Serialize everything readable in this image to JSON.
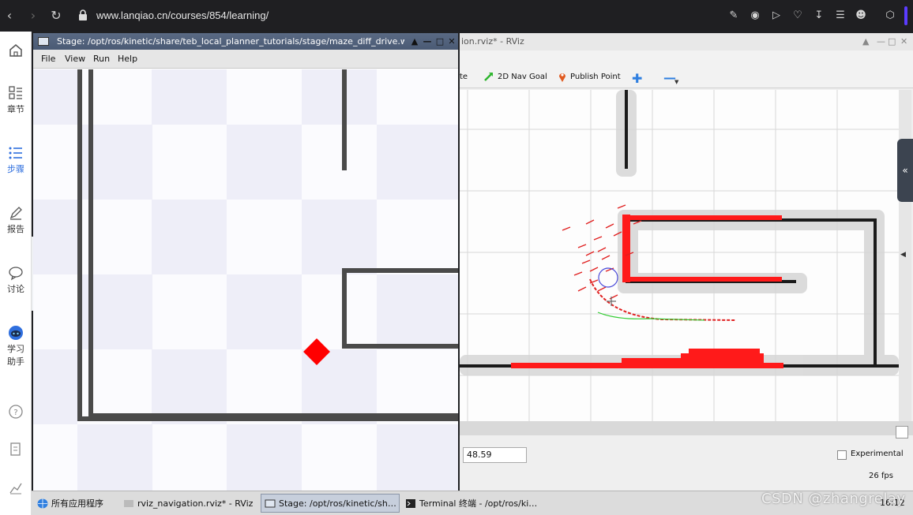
{
  "browser": {
    "url": "www.lanqiao.cn/courses/854/learning/"
  },
  "sidebar": {
    "items": [
      {
        "label": "章节",
        "icon": "chapters-icon"
      },
      {
        "label": "步骤",
        "icon": "steps-icon"
      },
      {
        "label": "报告",
        "icon": "report-icon"
      },
      {
        "label": "讨论",
        "icon": "discuss-icon"
      },
      {
        "label": "学习",
        "label2": "助手",
        "icon": "assistant-icon"
      }
    ],
    "active_color": "#2f6fde"
  },
  "stage": {
    "title": "Stage: /opt/ros/kinetic/share/teb_local_planner_tutorials/stage/maze_diff_drive.world",
    "menu": [
      "File",
      "View",
      "Run",
      "Help"
    ]
  },
  "rviz": {
    "title": "ion.rviz* - RViz",
    "toolbar": {
      "partial_label": "te",
      "nav_goal": "2D Nav Goal",
      "publish_point": "Publish Point"
    },
    "time_value": "48.59",
    "experimental_label": "Experimental",
    "fps": "26 fps"
  },
  "taskbar": {
    "start": "所有应用程序",
    "tasks": [
      "rviz_navigation.rviz* - RViz",
      "Stage: /opt/ros/kinetic/sh…",
      "Terminal 终端 - /opt/ros/ki…"
    ],
    "clock": "16:12"
  },
  "watermark": "CSDN @zhangrelay",
  "colors": {
    "robot": "#ff0000",
    "trajectory": "#e02020",
    "plan": "#33cc33"
  }
}
